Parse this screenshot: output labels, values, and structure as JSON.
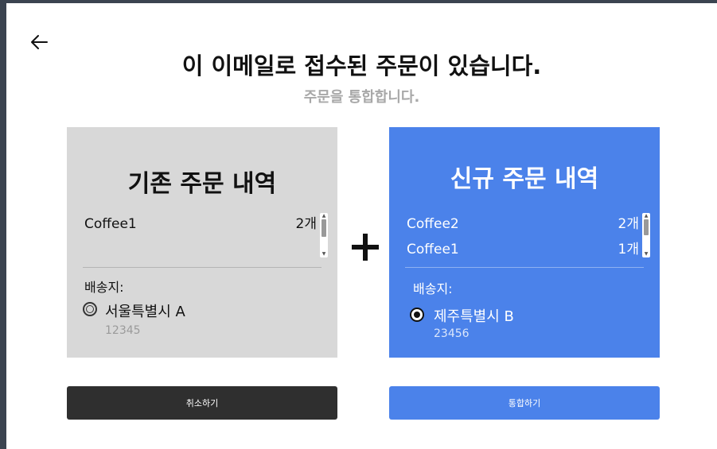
{
  "header": {
    "title": "이 이메일로 접수된 주문이 있습니다.",
    "subtitle": "주문을 통합합니다."
  },
  "existing_order": {
    "title": "기존 주문 내역",
    "items": [
      {
        "name": "Coffee1",
        "qty": "2개"
      }
    ],
    "address_label": "배송지:",
    "address_name": "서울특별시 A",
    "address_zip": "12345",
    "selected": false
  },
  "new_order": {
    "title": "신규 주문 내역",
    "items": [
      {
        "name": "Coffee2",
        "qty": "2개"
      },
      {
        "name": "Coffee1",
        "qty": "1개"
      }
    ],
    "address_label": "배송지:",
    "address_name": "제주특별시 B",
    "address_zip": "23456",
    "selected": true
  },
  "actions": {
    "cancel_label": "취소하기",
    "merge_label": "통합하기"
  },
  "colors": {
    "accent": "#4b82ea",
    "dark_button": "#2f2f2f",
    "existing_card": "#d8d8d8"
  },
  "icons": {
    "back": "arrow-left-icon",
    "plus": "plus-icon"
  }
}
